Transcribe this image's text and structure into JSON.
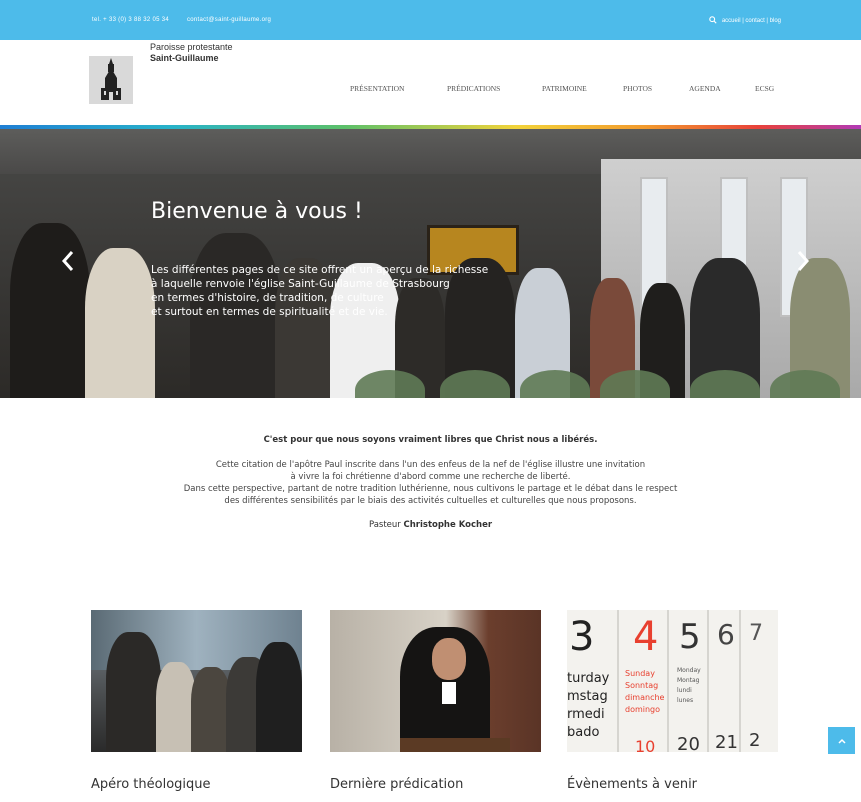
{
  "topbar": {
    "phone": "tel. + 33 (0) 3 88 32 05 34",
    "email": "contact@saint-guillaume.org",
    "links": "accueil | contact | blog",
    "icon": "search-icon"
  },
  "brand": {
    "line1": "Paroisse protestante",
    "line2": "Saint-Guillaume"
  },
  "nav": {
    "items": [
      "PRÉSENTATION",
      "PRÉDICATIONS",
      "PATRIMOINE",
      "PHOTOS",
      "AGENDA",
      "ECSG"
    ]
  },
  "hero": {
    "title": "Bienvenue à vous !",
    "lines": [
      "Les différentes pages de ce site offrent un aperçu de la richesse",
      "à laquelle renvoie l'église Saint-Guillaume de Strasbourg",
      "en termes d'histoire, de tradition, de culture",
      "et surtout en termes de spiritualité et de vie."
    ],
    "prev_icon": "chevron-left-icon",
    "next_icon": "chevron-right-icon"
  },
  "intro": {
    "quote": "C'est pour que nous soyons vraiment libres que Christ nous a libérés.",
    "lines": [
      "Cette citation de l'apôtre Paul inscrite dans l'un des enfeus de la nef de l'église illustre une invitation",
      "à vivre la foi chrétienne d'abord comme une recherche de liberté.",
      "Dans cette perspective, partant de notre tradition luthérienne, nous cultivons le partage et le débat dans le respect",
      "des différentes sensibilités par le biais des activités cultuelles et culturelles que nous proposons."
    ],
    "sign_prefix": "Pasteur",
    "sign_name": "Christophe Kocher"
  },
  "cards": [
    {
      "title": "Apéro théologique"
    },
    {
      "title": "Dernière prédication"
    },
    {
      "title": "Évènements à venir"
    }
  ],
  "calendar": {
    "numbers": [
      "3",
      "4",
      "5",
      "6",
      "7"
    ],
    "words1": [
      "turday",
      "mstag",
      "rmedi",
      "bado"
    ],
    "words_red": [
      "Sunday",
      "Sonntag",
      "dimanche",
      "domingo"
    ],
    "words3": [
      "Monday",
      "Montag",
      "lundi",
      "lunes"
    ],
    "bottom": [
      "10",
      "20",
      "21",
      "2"
    ]
  },
  "back_to_top_icon": "chevron-up-icon"
}
